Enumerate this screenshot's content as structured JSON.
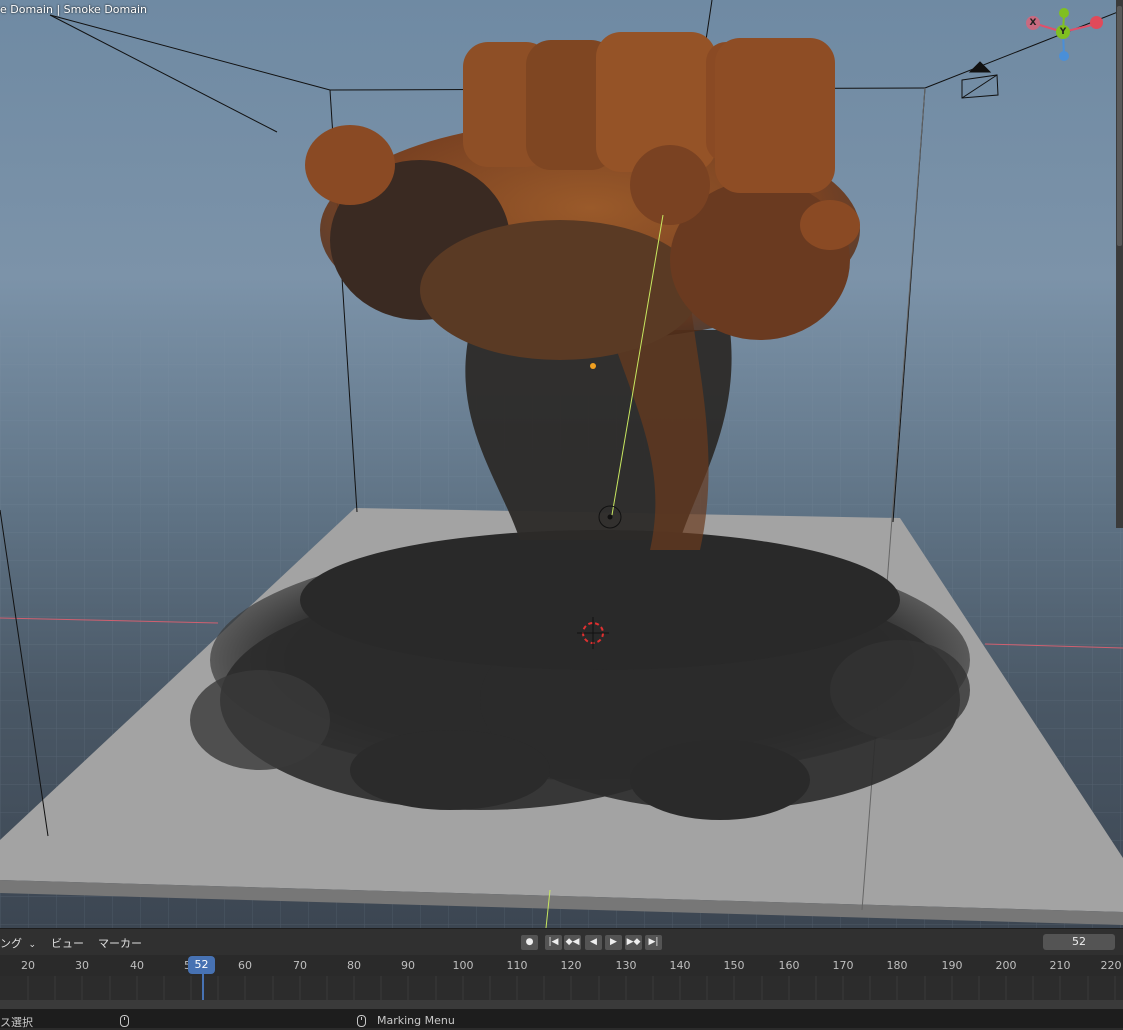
{
  "viewport": {
    "object_label": "e Domain | Smoke Domain",
    "gizmo": {
      "x": "X",
      "y": "Y",
      "x_color": "#e0506a",
      "y_color": "#80c020",
      "z_color": "#4a8fd8"
    }
  },
  "timeline": {
    "menu": {
      "mode": "ング",
      "view": "ビュー",
      "marker": "マーカー"
    },
    "playback_buttons": [
      "record",
      "jump-start",
      "prev-keyframe",
      "play-reverse",
      "play",
      "next-keyframe",
      "jump-end"
    ],
    "current_frame": "52",
    "ruler_ticks": [
      "20",
      "30",
      "40",
      "50",
      "60",
      "70",
      "80",
      "90",
      "100",
      "110",
      "120",
      "130",
      "140",
      "150",
      "160",
      "170",
      "180",
      "190",
      "200",
      "210",
      "220"
    ],
    "playhead_label": "52"
  },
  "statusbar": {
    "left": "ス選択",
    "middle": "Marking Menu"
  },
  "colors": {
    "smoke_orange": "#8a4a22",
    "smoke_dark": "#2a2a2a",
    "accent_blue": "#4772b3",
    "floor": "#9a9a9a"
  }
}
